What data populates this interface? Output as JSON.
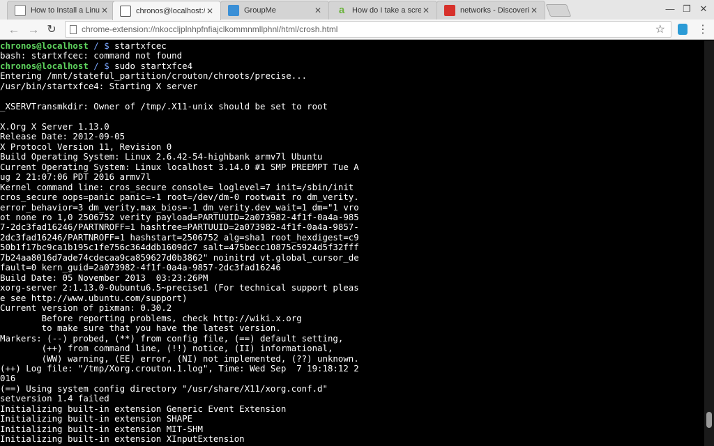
{
  "tabs": [
    {
      "title": "How to Install a Linux O",
      "favicon": "document-icon",
      "active": false
    },
    {
      "title": "chronos@localhost:/",
      "favicon": "document-icon",
      "active": true
    },
    {
      "title": "GroupMe",
      "favicon": "groupme-icon",
      "active": false
    },
    {
      "title": "How do I take a screens",
      "favicon": "answers-icon",
      "active": false
    },
    {
      "title": "networks - Discovering t",
      "favicon": "stackexchange-icon",
      "active": false
    }
  ],
  "toolbar": {
    "url": "chrome-extension://nkoccljplnhpfnfiajclkommnmllphnl/html/crosh.html"
  },
  "terminal": {
    "lines": [
      {
        "user": "chronos@localhost",
        "path": " / $ ",
        "text": "startxfcec"
      },
      {
        "text": "bash: startxfcec: command not found"
      },
      {
        "user": "chronos@localhost",
        "path": " / $ ",
        "text": "sudo startxfce4"
      },
      {
        "text": "Entering /mnt/stateful_partition/crouton/chroots/precise..."
      },
      {
        "text": "/usr/bin/startxfce4: Starting X server"
      },
      {
        "text": ""
      },
      {
        "text": "_XSERVTransmkdir: Owner of /tmp/.X11-unix should be set to root"
      },
      {
        "text": ""
      },
      {
        "text": "X.Org X Server 1.13.0"
      },
      {
        "text": "Release Date: 2012-09-05"
      },
      {
        "text": "X Protocol Version 11, Revision 0"
      },
      {
        "text": "Build Operating System: Linux 2.6.42-54-highbank armv7l Ubuntu"
      },
      {
        "text": "Current Operating System: Linux localhost 3.14.0 #1 SMP PREEMPT Tue A"
      },
      {
        "text": "ug 2 21:07:06 PDT 2016 armv7l"
      },
      {
        "text": "Kernel command line: cros_secure console= loglevel=7 init=/sbin/init"
      },
      {
        "text": "cros_secure oops=panic panic=-1 root=/dev/dm-0 rootwait ro dm_verity."
      },
      {
        "text": "error_behavior=3 dm_verity.max_bios=-1 dm_verity.dev_wait=1 dm=\"1 vro"
      },
      {
        "text": "ot none ro 1,0 2506752 verity payload=PARTUUID=2a073982-4f1f-0a4a-985"
      },
      {
        "text": "7-2dc3fad16246/PARTNROFF=1 hashtree=PARTUUID=2a073982-4f1f-0a4a-9857-"
      },
      {
        "text": "2dc3fad16246/PARTNROFF=1 hashstart=2506752 alg=sha1 root_hexdigest=c9"
      },
      {
        "text": "50b1f17bc9ca1b195c1fe756c364ddb1609dc7 salt=475becc10875c5924d5f32fff"
      },
      {
        "text": "7b24aa8016d7ade74cdecaa9ca859627d0b3862\" noinitrd vt.global_cursor_de"
      },
      {
        "text": "fault=0 kern_guid=2a073982-4f1f-0a4a-9857-2dc3fad16246"
      },
      {
        "text": "Build Date: 05 November 2013  03:23:26PM"
      },
      {
        "text": "xorg-server 2:1.13.0-0ubuntu6.5~precise1 (For technical support pleas"
      },
      {
        "text": "e see http://www.ubuntu.com/support)"
      },
      {
        "text": "Current version of pixman: 0.30.2"
      },
      {
        "text": "        Before reporting problems, check http://wiki.x.org"
      },
      {
        "text": "        to make sure that you have the latest version."
      },
      {
        "text": "Markers: (--) probed, (**) from config file, (==) default setting,"
      },
      {
        "text": "        (++) from command line, (!!) notice, (II) informational,"
      },
      {
        "text": "        (WW) warning, (EE) error, (NI) not implemented, (??) unknown."
      },
      {
        "text": "(++) Log file: \"/tmp/Xorg.crouton.1.log\", Time: Wed Sep  7 19:18:12 2"
      },
      {
        "text": "016"
      },
      {
        "text": "(==) Using system config directory \"/usr/share/X11/xorg.conf.d\""
      },
      {
        "text": "setversion 1.4 failed"
      },
      {
        "text": "Initializing built-in extension Generic Event Extension"
      },
      {
        "text": "Initializing built-in extension SHAPE"
      },
      {
        "text": "Initializing built-in extension MIT-SHM"
      },
      {
        "text": "Initializing built-in extension XInputExtension"
      }
    ]
  },
  "scrollbar": {
    "thumb_start": 0.915,
    "thumb_end": 0.955
  }
}
